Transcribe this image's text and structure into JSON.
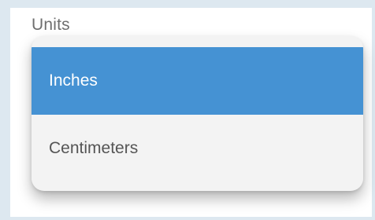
{
  "field": {
    "label": "Units"
  },
  "dropdown": {
    "options": [
      {
        "label": "Inches",
        "selected": true
      },
      {
        "label": "Centimeters",
        "selected": false
      }
    ]
  },
  "colors": {
    "selected_bg": "#4592d3",
    "selected_text": "#ffffff",
    "option_bg": "#f3f3f3",
    "option_text": "#555555",
    "page_bg": "#dde8f0"
  }
}
